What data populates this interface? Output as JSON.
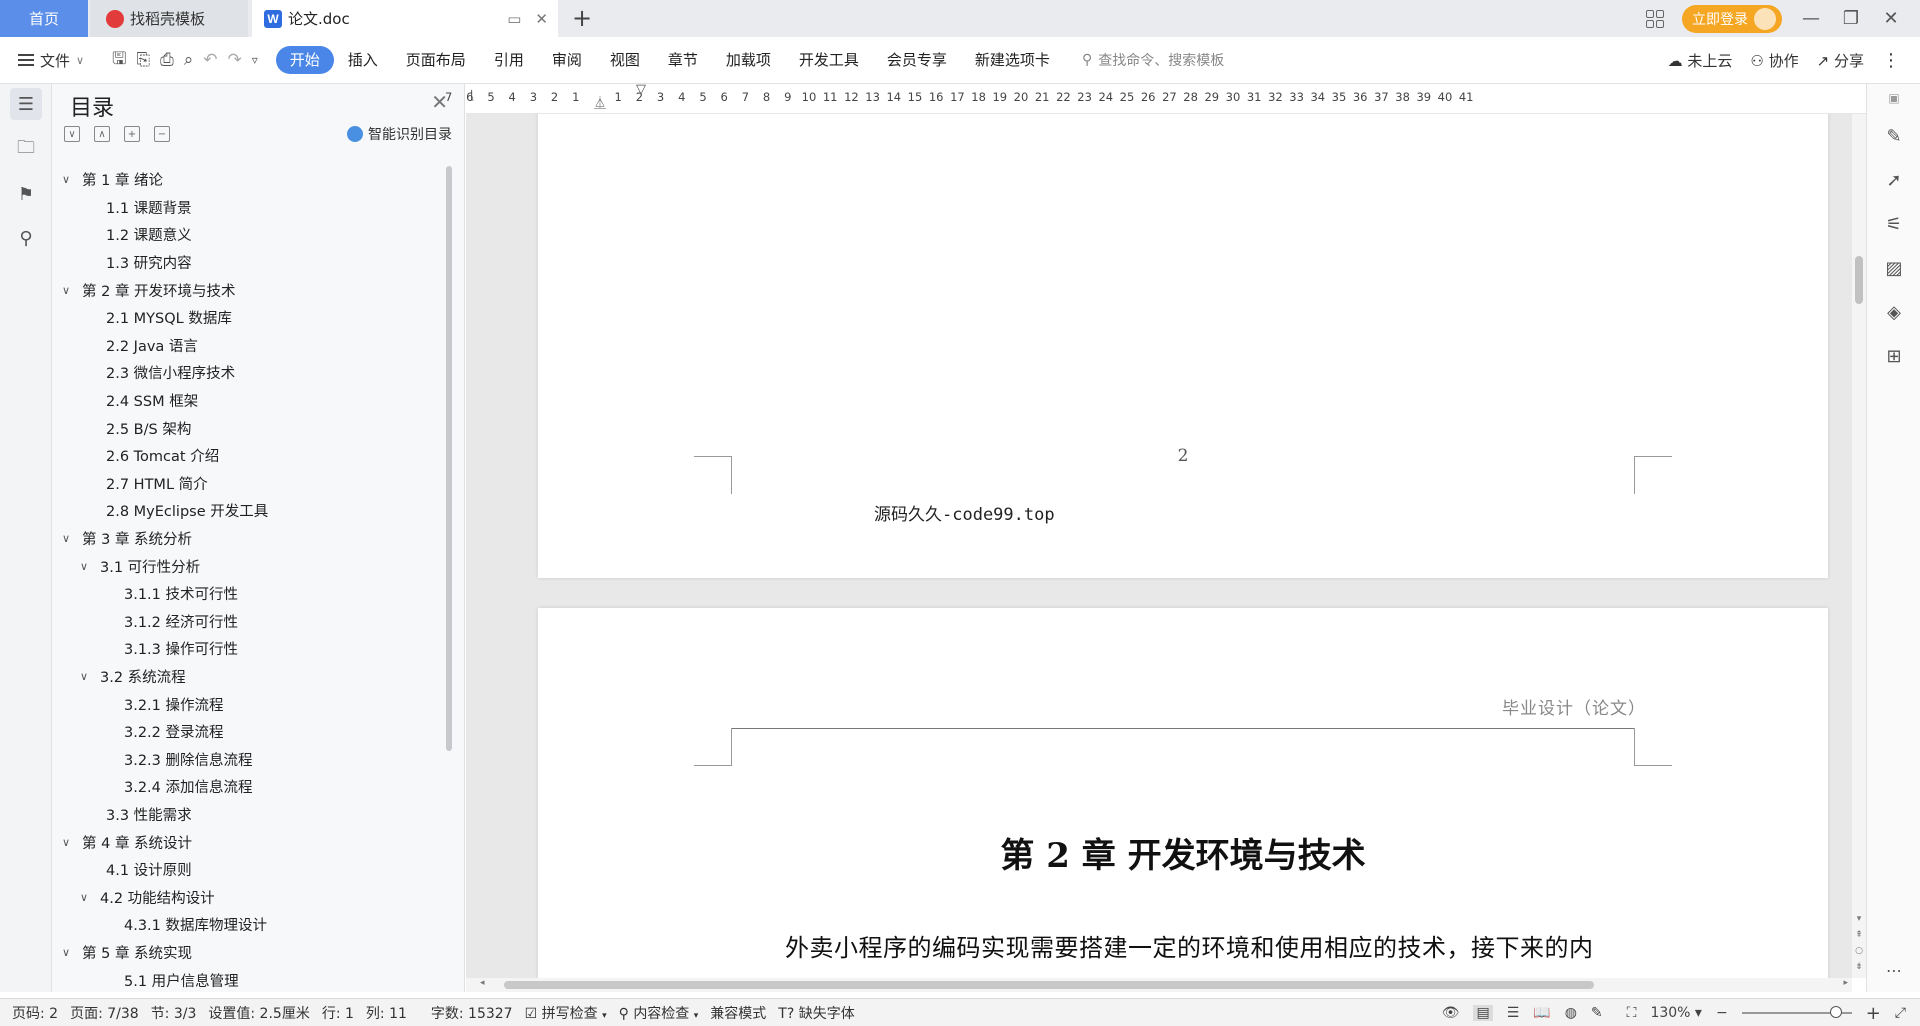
{
  "tabs": {
    "home": "首页",
    "docer": "找稻壳模板",
    "document": "论文.doc",
    "add": "+"
  },
  "title_bar": {
    "login_label": "立即登录"
  },
  "ribbon": {
    "file_label": "文件",
    "menu_tabs": [
      "开始",
      "插入",
      "页面布局",
      "引用",
      "审阅",
      "视图",
      "章节",
      "加载项",
      "开发工具",
      "会员专享",
      "新建选项卡"
    ],
    "search_placeholder": "查找命令、搜索模板",
    "cloud_label": "未上云",
    "collab_label": "协作",
    "share_label": "分享"
  },
  "toc": {
    "title": "目录",
    "smart_label": "智能识别目录",
    "items": [
      {
        "text": "第 1 章  绪论",
        "level": 0,
        "caret": true
      },
      {
        "text": "1.1  课题背景",
        "level": 1,
        "caret": false
      },
      {
        "text": "1.2  课题意义",
        "level": 1,
        "caret": false
      },
      {
        "text": "1.3  研究内容",
        "level": 1,
        "caret": false
      },
      {
        "text": "第 2 章  开发环境与技术",
        "level": 0,
        "caret": true
      },
      {
        "text": "2.1  MYSQL 数据库",
        "level": 1,
        "caret": false
      },
      {
        "text": "2.2  Java 语言",
        "level": 1,
        "caret": false
      },
      {
        "text": "2.3  微信小程序技术",
        "level": 1,
        "caret": false
      },
      {
        "text": "2.4  SSM 框架",
        "level": 1,
        "caret": false
      },
      {
        "text": "2.5  B/S 架构",
        "level": 1,
        "caret": false
      },
      {
        "text": "2.6  Tomcat  介绍",
        "level": 1,
        "caret": false
      },
      {
        "text": "2.7  HTML 简介",
        "level": 1,
        "caret": false
      },
      {
        "text": "2.8  MyEclipse 开发工具",
        "level": 1,
        "caret": false
      },
      {
        "text": "第 3 章  系统分析",
        "level": 0,
        "caret": true
      },
      {
        "text": "3.1  可行性分析",
        "level": 1,
        "caret": true
      },
      {
        "text": "3.1.1  技术可行性",
        "level": 2,
        "caret": false
      },
      {
        "text": "3.1.2  经济可行性",
        "level": 2,
        "caret": false
      },
      {
        "text": "3.1.3  操作可行性",
        "level": 2,
        "caret": false
      },
      {
        "text": "3.2  系统流程",
        "level": 1,
        "caret": true
      },
      {
        "text": "3.2.1  操作流程",
        "level": 2,
        "caret": false
      },
      {
        "text": "3.2.2  登录流程",
        "level": 2,
        "caret": false
      },
      {
        "text": "3.2.3  删除信息流程",
        "level": 2,
        "caret": false
      },
      {
        "text": "3.2.4  添加信息流程",
        "level": 2,
        "caret": false
      },
      {
        "text": "3.3  性能需求",
        "level": 1,
        "caret": false
      },
      {
        "text": "第 4 章  系统设计",
        "level": 0,
        "caret": true
      },
      {
        "text": "4.1  设计原则",
        "level": 1,
        "caret": false
      },
      {
        "text": "4.2  功能结构设计",
        "level": 1,
        "caret": true
      },
      {
        "text": "4.3.1  数据库物理设计",
        "level": 2,
        "caret": false
      },
      {
        "text": "第 5 章  系统实现",
        "level": 0,
        "caret": true
      },
      {
        "text": "5.1 用户信息管理",
        "level": 2,
        "caret": false
      }
    ]
  },
  "ruler": {
    "left_numbers": [
      "7",
      "6",
      "5",
      "4",
      "3",
      "2",
      "1"
    ],
    "right_numbers": [
      "1",
      "2",
      "3",
      "4",
      "5",
      "6",
      "7",
      "8",
      "9",
      "10",
      "11",
      "12",
      "13",
      "14",
      "15",
      "16",
      "17",
      "18",
      "19",
      "20",
      "21",
      "22",
      "23",
      "24",
      "25",
      "26",
      "27",
      "28",
      "29",
      "30",
      "31",
      "32",
      "33",
      "34",
      "35",
      "36",
      "37",
      "38",
      "39",
      "40",
      "41"
    ]
  },
  "document": {
    "page_number": "2",
    "source_text": "源码久久-code99.top",
    "header_text": "毕业设计（论文）",
    "chapter_title": "第 2 章  开发环境与技术",
    "body_line": "外卖小程序的编码实现需要搭建一定的环境和使用相应的技术，接下来的内"
  },
  "status": {
    "page_code": "页码: 2",
    "page_count": "页面: 7/38",
    "section": "节: 3/3",
    "setting": "设置值: 2.5厘米",
    "row": "行: 1",
    "col": "列: 11",
    "word_count": "字数: 15327",
    "spell_check": "拼写检查",
    "content_check": "内容检查",
    "compat_mode": "兼容模式",
    "missing_font": "缺失字体",
    "zoom": "130%"
  }
}
